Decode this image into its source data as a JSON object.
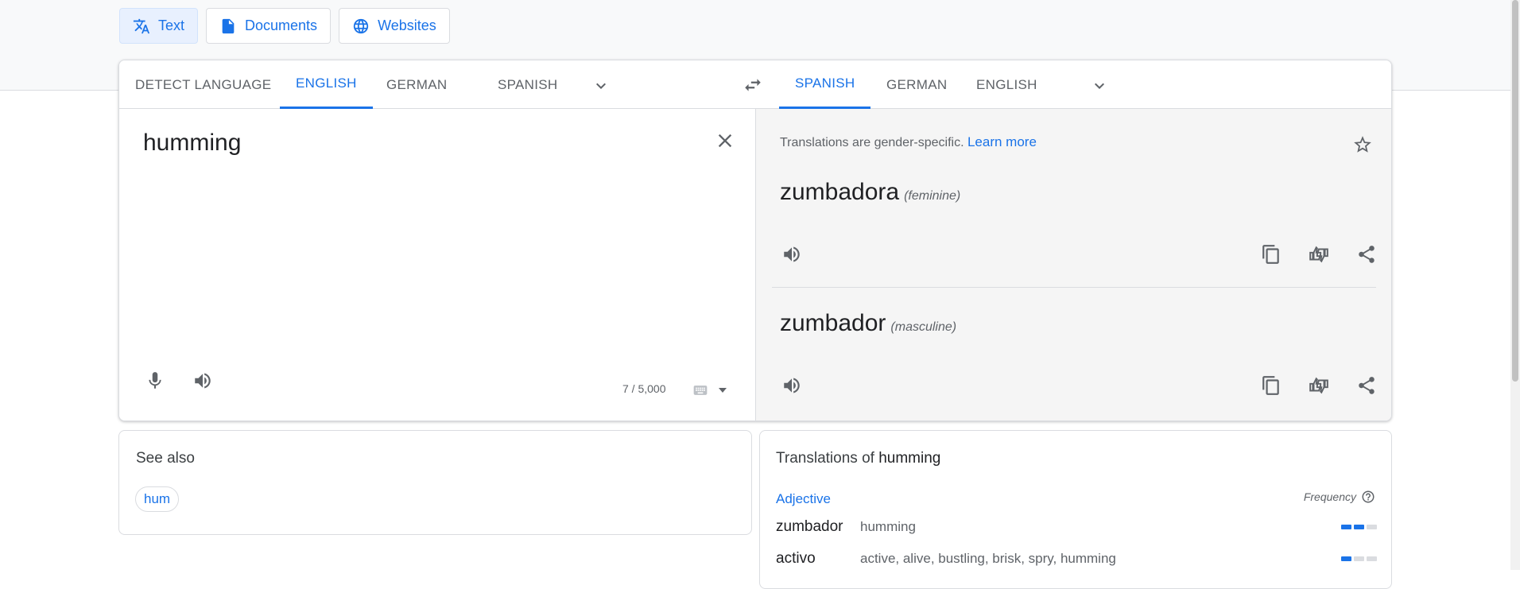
{
  "modes": [
    {
      "label": "Text",
      "icon": "translate-icon",
      "active": true
    },
    {
      "label": "Documents",
      "icon": "document-icon"
    },
    {
      "label": "Websites",
      "icon": "globe-icon"
    }
  ],
  "source_langs": [
    "DETECT LANGUAGE",
    "ENGLISH",
    "GERMAN",
    "SPANISH"
  ],
  "target_langs": [
    "SPANISH",
    "GERMAN",
    "ENGLISH"
  ],
  "source": {
    "text": "humming",
    "char_count": "7 / 5,000"
  },
  "target": {
    "note": "Translations are gender-specific.",
    "learn_more": "Learn more",
    "results": [
      {
        "word": "zumbadora",
        "gender": "(feminine)"
      },
      {
        "word": "zumbador",
        "gender": "(masculine)"
      }
    ]
  },
  "see_also": {
    "title": "See also",
    "chips": [
      "hum"
    ]
  },
  "translations_of": {
    "prefix": "Translations of",
    "term": "humming",
    "pos": "Adjective",
    "frequency_label": "Frequency",
    "rows": [
      {
        "word": "zumbador",
        "synonyms": "humming",
        "frequency": 2
      },
      {
        "word": "activo",
        "synonyms": "active, alive, bustling, brisk, spry, humming",
        "frequency": 1
      }
    ]
  },
  "colors": {
    "accent": "#1a73e8",
    "pane_bg": "#f5f5f5"
  }
}
